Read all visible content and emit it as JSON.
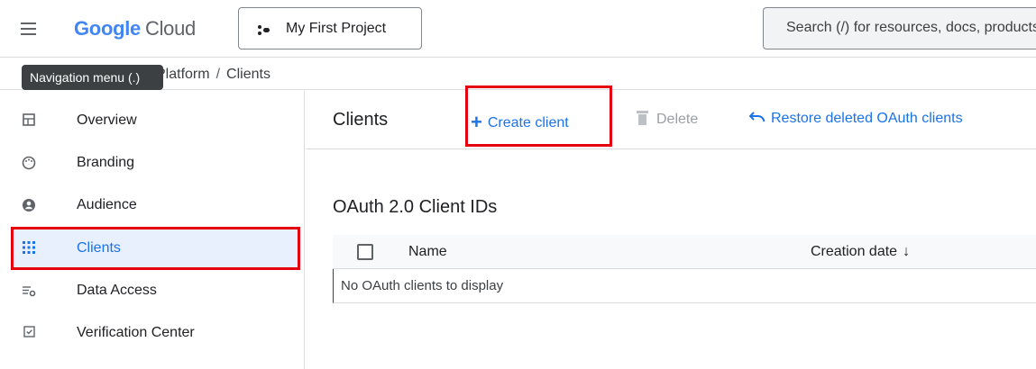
{
  "header": {
    "logo_google": "Google",
    "logo_cloud": "Cloud",
    "project_label": "My First Project",
    "search_placeholder": "Search (/) for resources, docs, products, and more"
  },
  "tooltip": {
    "text": "Navigation menu (.)"
  },
  "breadcrumb": {
    "part1": "Platform",
    "separator": "/",
    "part2": "Clients"
  },
  "sidebar": {
    "items": [
      {
        "label": "Overview",
        "icon": "dashboard-icon"
      },
      {
        "label": "Branding",
        "icon": "palette-icon"
      },
      {
        "label": "Audience",
        "icon": "account-circle-icon"
      },
      {
        "label": "Clients",
        "icon": "apps-grid-icon",
        "active": true
      },
      {
        "label": "Data Access",
        "icon": "tune-gear-icon"
      },
      {
        "label": "Verification Center",
        "icon": "checkbox-icon"
      }
    ]
  },
  "main": {
    "title": "Clients",
    "toolbar": {
      "create_label": "Create client",
      "delete_label": "Delete",
      "restore_label": "Restore deleted OAuth clients"
    },
    "section_title": "OAuth 2.0 Client IDs",
    "table": {
      "columns": [
        "Name",
        "Creation date"
      ],
      "sort_indicator": "↓",
      "empty_message": "No OAuth clients to display"
    }
  },
  "colors": {
    "accent": "#1a73e8",
    "highlight": "#e4000f",
    "active_bg": "#e8f0fe"
  }
}
